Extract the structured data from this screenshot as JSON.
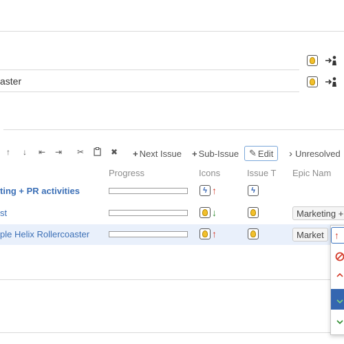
{
  "top_field": {
    "text": "aster"
  },
  "toolbar": {
    "move_up": "↑",
    "move_down": "↓",
    "to_first": "⇤",
    "to_last": "⇥",
    "cut": "✂",
    "paste": "📋",
    "delete": "✖",
    "next_issue_plus": "+",
    "next_issue": "Next Issue",
    "sub_issue_plus": "+",
    "sub_issue": "Sub-Issue",
    "edit_icon": "✎",
    "edit": "Edit",
    "unresolved_chevron": "›",
    "unresolved": "Unresolved"
  },
  "columns": {
    "progress": "Progress",
    "icons": "Icons",
    "issue_type": "Issue T",
    "epic_name": "Epic Nam"
  },
  "rows": [
    {
      "title": "ting + PR activities",
      "epic": "",
      "priority": "up",
      "type": "epic",
      "progress": 0
    },
    {
      "title": "st",
      "epic": "Marketing +",
      "priority": "down",
      "type": "idea",
      "progress": 0
    },
    {
      "title": "ple Helix Rollercoaster",
      "epic": "Market",
      "priority": "up",
      "type": "idea",
      "progress": 0
    }
  ],
  "colors": {
    "link_blue": "#3b6fb6",
    "selected_row": "#e9f0fb",
    "priority_up": "#d43c2b",
    "priority_down": "#2e8b2e",
    "highlight": "#3466b0"
  },
  "icons": {
    "idea": "lightbulb-icon",
    "epic": "lightning-icon",
    "assign": "assign-person-icon"
  }
}
